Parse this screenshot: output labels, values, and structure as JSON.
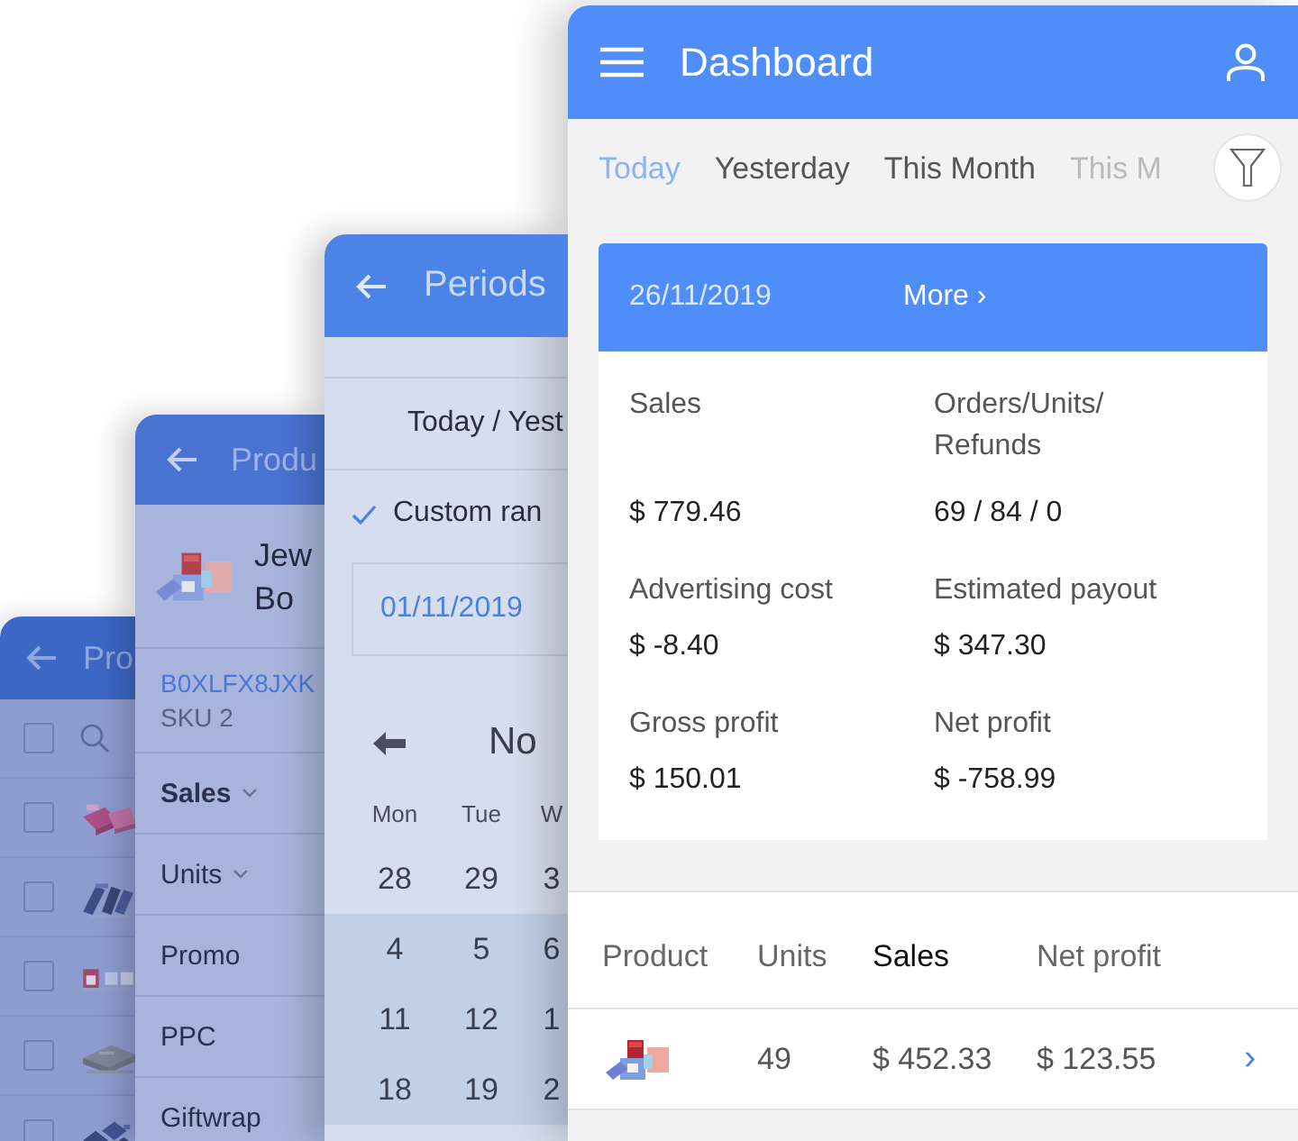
{
  "product_list_screen": {
    "title": "Pro",
    "select_all": {
      "checked": false
    },
    "rows": [
      {
        "checked": false
      },
      {
        "checked": false
      },
      {
        "checked": false
      },
      {
        "checked": false
      },
      {
        "checked": false
      }
    ]
  },
  "product_detail_screen": {
    "title": "Produ",
    "product_name_lines": [
      "Jew",
      "Bo"
    ],
    "asin": "B0XLFX8JXK",
    "sku": "SKU 2",
    "items": [
      {
        "label": "Sales",
        "kind": "dropdown",
        "selected": true
      },
      {
        "label": "Units",
        "kind": "dropdown",
        "selected": false
      },
      {
        "label": "Promo",
        "kind": "plain",
        "selected": false
      },
      {
        "label": "PPC",
        "kind": "plain",
        "selected": false
      },
      {
        "label": "Giftwrap",
        "kind": "plain",
        "selected": false
      }
    ]
  },
  "periods_screen": {
    "title": "Periods",
    "options": [
      {
        "label": "Today / Yest",
        "checked": false
      },
      {
        "label": "Custom ran",
        "checked": true
      }
    ],
    "date_from": "01/11/2019",
    "month_label": "No",
    "weekdays": [
      "Mon",
      "Tue",
      "W"
    ],
    "weeks": [
      {
        "days": [
          "28",
          "29",
          "3"
        ],
        "in_range": false
      },
      {
        "days": [
          "4",
          "5",
          "6"
        ],
        "in_range": true
      },
      {
        "days": [
          "11",
          "12",
          "1"
        ],
        "in_range": true
      },
      {
        "days": [
          "18",
          "19",
          "2"
        ],
        "in_range": true
      }
    ]
  },
  "dashboard_screen": {
    "title": "Dashboard",
    "tabs": [
      {
        "label": "Today",
        "selected": true
      },
      {
        "label": "Yesterday",
        "selected": false
      },
      {
        "label": "This Month",
        "selected": false
      },
      {
        "label": "This M",
        "selected": false
      }
    ],
    "summary": {
      "date": "26/11/2019",
      "more": "More ›",
      "metrics": [
        {
          "label": "Sales",
          "value": "$ 779.46"
        },
        {
          "label": "Orders/Units/Refunds",
          "value": "69 / 84 / 0"
        },
        {
          "label": "Advertising cost",
          "value": "$ -8.40"
        },
        {
          "label": "Estimated payout",
          "value": "$ 347.30"
        },
        {
          "label": "Gross profit",
          "value": "$ 150.01"
        },
        {
          "label": "Net profit",
          "value": "$ -758.99"
        }
      ]
    },
    "table": {
      "columns": [
        {
          "label": "Product",
          "sorted": false
        },
        {
          "label": "Units",
          "sorted": false
        },
        {
          "label": "Sales",
          "sorted": true
        },
        {
          "label": "Net profit",
          "sorted": false
        }
      ],
      "rows": [
        {
          "units": "49",
          "sales": "$ 452.33",
          "net_profit": "$ 123.55",
          "chevron": "›"
        }
      ]
    }
  }
}
